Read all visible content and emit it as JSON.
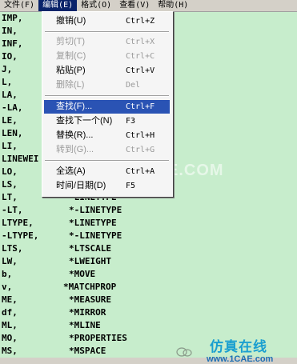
{
  "menubar": {
    "items": [
      "文件(F)",
      "编辑(E)",
      "格式(O)",
      "查看(V)",
      "帮助(H)"
    ]
  },
  "edit_menu": {
    "items": [
      {
        "label": "撤销(U)",
        "shortcut": "Ctrl+Z",
        "state": "enabled"
      },
      {
        "label": "剪切(T)",
        "shortcut": "Ctrl+X",
        "state": "disabled"
      },
      {
        "label": "复制(C)",
        "shortcut": "Ctrl+C",
        "state": "disabled"
      },
      {
        "label": "粘贴(P)",
        "shortcut": "Ctrl+V",
        "state": "enabled"
      },
      {
        "label": "删除(L)",
        "shortcut": "Del",
        "state": "disabled"
      },
      {
        "label": "查找(F)...",
        "shortcut": "Ctrl+F",
        "state": "highlighted"
      },
      {
        "label": "查找下一个(N)",
        "shortcut": "F3",
        "state": "enabled"
      },
      {
        "label": "替换(R)...",
        "shortcut": "Ctrl+H",
        "state": "enabled"
      },
      {
        "label": "转到(G)...",
        "shortcut": "Ctrl+G",
        "state": "disabled"
      },
      {
        "label": "全选(A)",
        "shortcut": "Ctrl+A",
        "state": "enabled"
      },
      {
        "label": "时间/日期(D)",
        "shortcut": "F5",
        "state": "enabled"
      }
    ]
  },
  "editor": {
    "left_lines": [
      "IMP,",
      "IN,",
      "INF,",
      "IO,",
      "J,",
      "L,",
      "LA,",
      "-LA,",
      "LE,",
      "LEN,",
      "LI,",
      "LINEWEI",
      "LO,",
      "LS,",
      "LT,",
      "-LT,",
      "LTYPE,",
      "-LTYPE,",
      "LTS,",
      "LW,",
      "b,",
      "v,",
      "ME,",
      "df,",
      "ML,",
      "MO,",
      "MS,"
    ],
    "right_commands": [
      "*LINETYPE",
      "*-LINETYPE",
      "*LINETYPE",
      "*-LINETYPE",
      "*LTSCALE",
      "*LWEIGHT",
      "*MOVE",
      "*MATCHPROP",
      "*MEASURE",
      "*MIRROR",
      "*MLINE",
      "*PROPERTIES",
      "*MSPACE"
    ]
  },
  "watermarks": {
    "center": "1CAE.COM",
    "brand": "仿真在线",
    "url": "www.1CAE.com"
  },
  "colors": {
    "editor_bg": "#c7edcc",
    "menu_highlight": "#2a53b4",
    "menubar_active": "#0a246a"
  }
}
